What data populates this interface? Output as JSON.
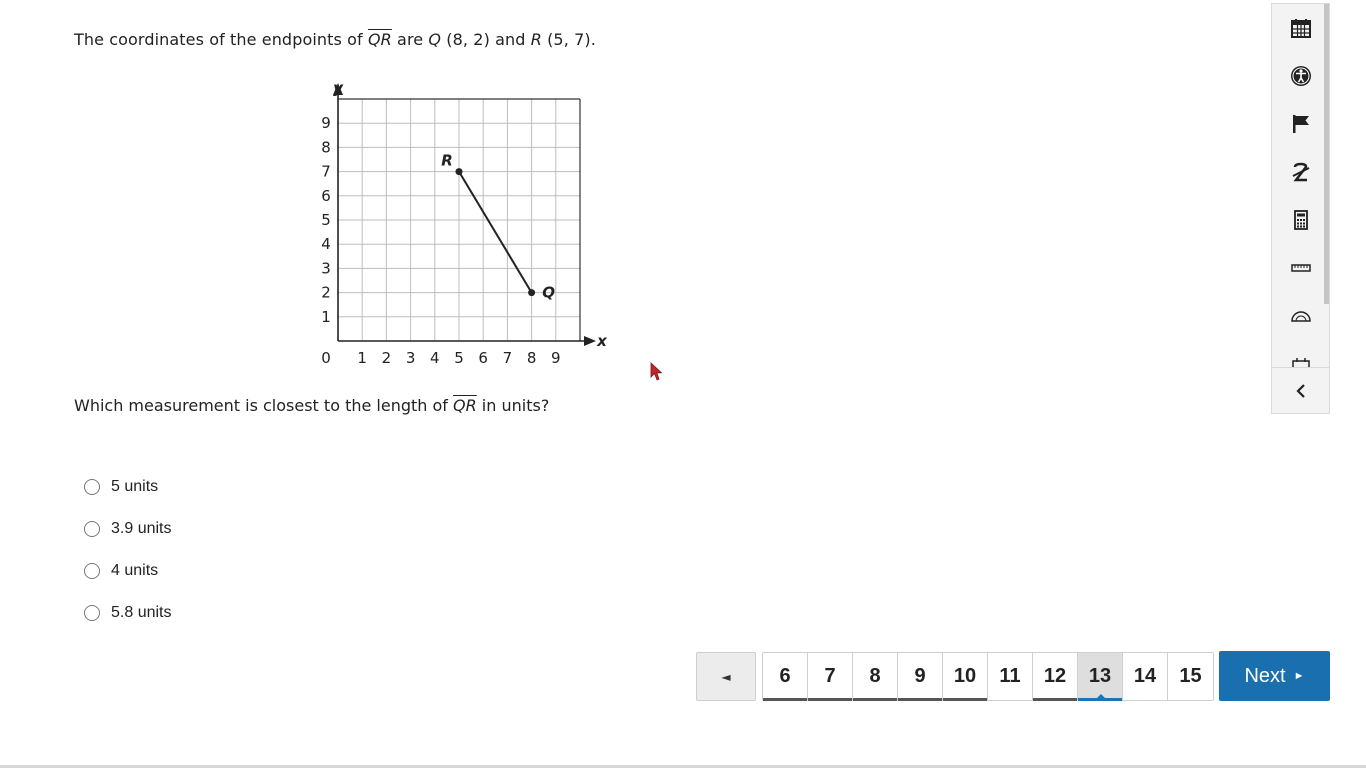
{
  "question": {
    "prefix": "The coordinates of the endpoints of ",
    "segment": "QR",
    "mid": " are ",
    "q_label": "Q",
    "q_coords": " (8, 2) and ",
    "r_label": "R",
    "r_coords": " (5, 7)."
  },
  "graph": {
    "x_axis_label": "x",
    "y_axis_label": "y",
    "origin_label": "0",
    "x_ticks": [
      "1",
      "2",
      "3",
      "4",
      "5",
      "6",
      "7",
      "8",
      "9"
    ],
    "y_ticks": [
      "1",
      "2",
      "3",
      "4",
      "5",
      "6",
      "7",
      "8",
      "9"
    ],
    "points": [
      {
        "label": "R",
        "x": 5,
        "y": 7
      },
      {
        "label": "Q",
        "x": 8,
        "y": 2
      }
    ]
  },
  "question2": {
    "prefix": "Which measurement is closest to the length of ",
    "segment": "QR",
    "suffix": " in units?"
  },
  "choices": [
    "5 units",
    "3.9 units",
    "4 units",
    "5.8 units"
  ],
  "tools": [
    "calendar-icon",
    "accessibility-icon",
    "flag-icon",
    "strikethrough-icon",
    "calculator-icon",
    "ruler-icon",
    "protractor-icon"
  ],
  "pager": {
    "prev_symbol": "◄",
    "pages": [
      "6",
      "7",
      "8",
      "9",
      "10",
      "11",
      "12",
      "13",
      "14",
      "15"
    ],
    "current": "13",
    "next_label": "Next",
    "next_symbol": "►"
  }
}
